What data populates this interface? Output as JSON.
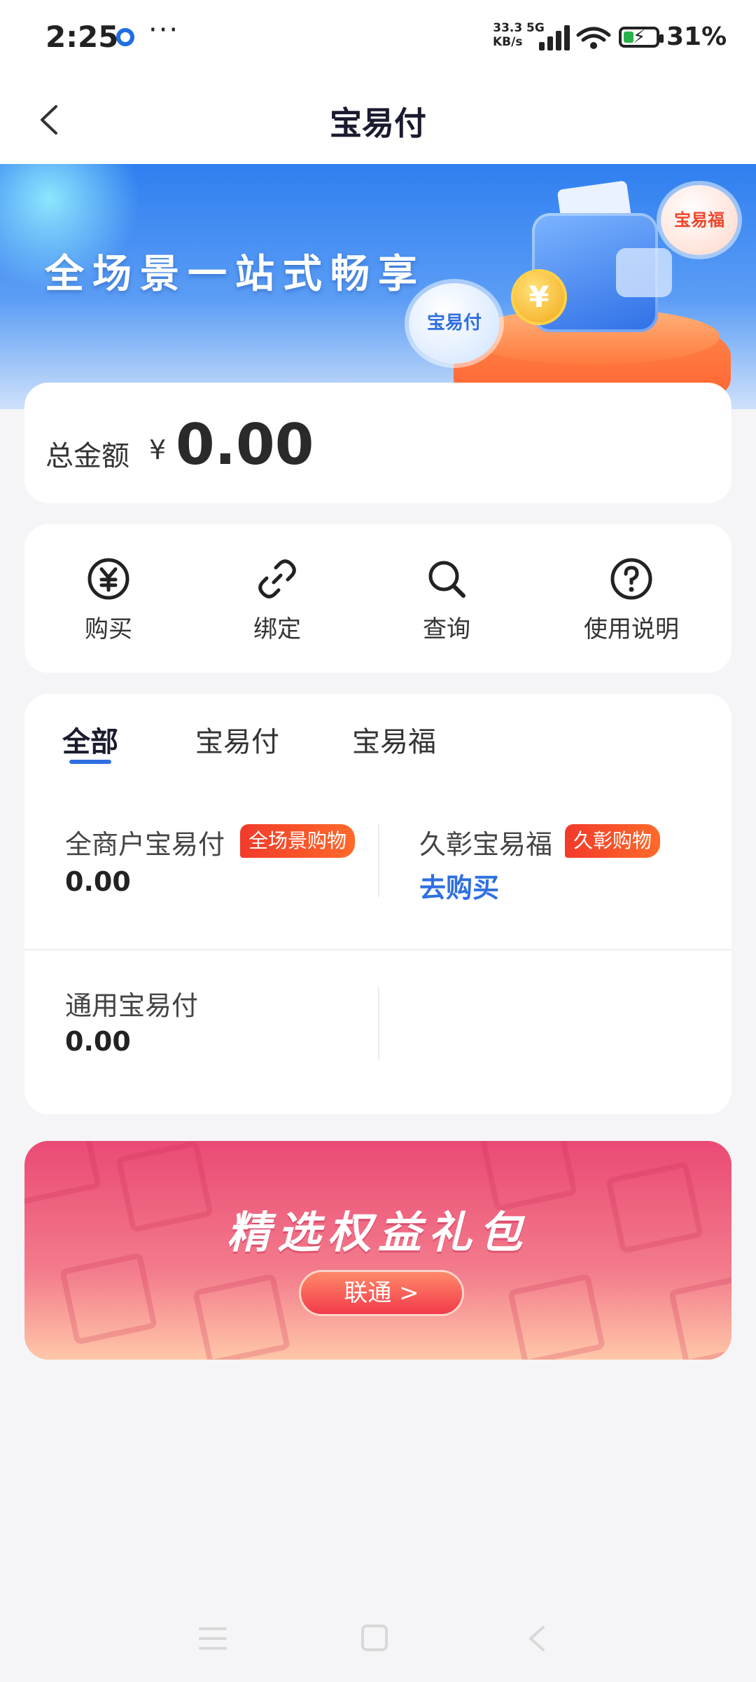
{
  "status_bar": {
    "time": "2:25",
    "more": "···",
    "speed_top": "33.3",
    "speed_unit": "KB/s",
    "network": "5G",
    "battery": "31%"
  },
  "nav": {
    "title": "宝易付"
  },
  "banner": {
    "slogan": "全场景一站式畅享",
    "bubble_fu": "宝易福",
    "bubble_pay": "宝易付",
    "coin": "¥"
  },
  "total": {
    "label": "总金额",
    "currency": "¥",
    "amount": "0.00"
  },
  "actions": [
    {
      "label": "购买",
      "icon": "yuan-circle-icon"
    },
    {
      "label": "绑定",
      "icon": "link-icon"
    },
    {
      "label": "查询",
      "icon": "search-icon"
    },
    {
      "label": "使用说明",
      "icon": "question-circle-icon"
    }
  ],
  "tabs": [
    {
      "label": "全部",
      "active": true
    },
    {
      "label": "宝易付",
      "active": false
    },
    {
      "label": "宝易福",
      "active": false
    }
  ],
  "balances": [
    {
      "name": "全商户宝易付",
      "tag": "全场景购物",
      "value": "0.00"
    },
    {
      "name": "久彰宝易福",
      "tag": "久彰购物",
      "link": "去购买"
    },
    {
      "name": "通用宝易付",
      "value": "0.00"
    }
  ],
  "promo": {
    "title": "精选权益礼包",
    "button": "联通 >"
  },
  "colors": {
    "accent": "#2f6fe2",
    "tag": "#f23a2a",
    "promo": "#ea4a74"
  }
}
